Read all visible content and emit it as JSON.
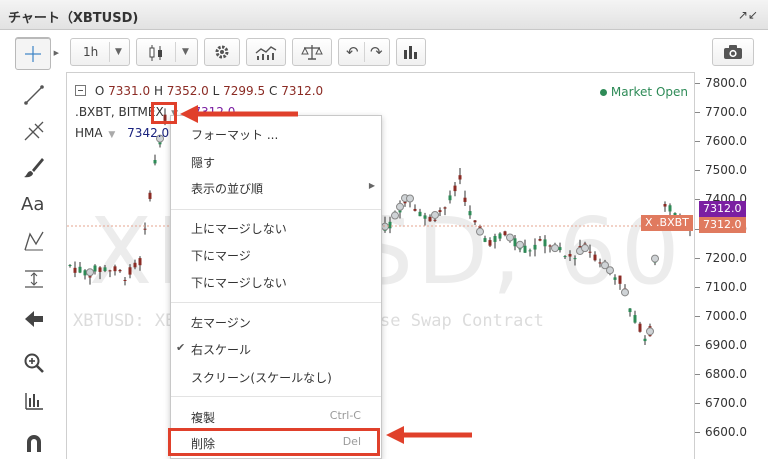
{
  "window": {
    "title": "チャート（XBTUSD)"
  },
  "toolbar": {
    "interval": "1h"
  },
  "chart": {
    "symbol_watermark": "XBTUSD, 60",
    "description_watermark": "XBTUSD: XBTUSD Perpetual Inverse Swap Contract",
    "ohlc": {
      "o_label": "O",
      "o": "7331.0",
      "h_label": "H",
      "h": "7352.0",
      "l_label": "L",
      "l": "7299.5",
      "c_label": "C",
      "c": "7312.0"
    },
    "market_status": "Market Open",
    "index_series": ".BXBT, BITMEX",
    "index_value": "7312.0",
    "indicator": "HMA",
    "indicator_value": "7342.090",
    "badges": [
      {
        "text": "7312.0",
        "color": "#7b1fa2"
      },
      {
        "text": "X .BXBT",
        "color": "#7b1fa2"
      },
      {
        "text": "7312.0",
        "color": "#e07a5f"
      }
    ]
  },
  "yaxis": {
    "ticks": [
      "7800.0",
      "7700.0",
      "7600.0",
      "7500.0",
      "7400.0",
      "7300.0",
      "7200.0",
      "7100.0",
      "7000.0",
      "6900.0",
      "6800.0",
      "6700.0",
      "6600.0"
    ]
  },
  "menu": {
    "items": [
      {
        "label": "フォーマット ..."
      },
      {
        "label": "隠す"
      },
      {
        "label": "表示の並び順"
      },
      {
        "label": "上にマージしない"
      },
      {
        "label": "下にマージ"
      },
      {
        "label": "下にマージしない"
      },
      {
        "label": "左マージン"
      },
      {
        "label": "右スケール"
      },
      {
        "label": "スクリーン(スケールなし)"
      },
      {
        "label": "複製",
        "shortcut": "Ctrl-C"
      },
      {
        "label": "削除",
        "shortcut": "Del"
      }
    ]
  },
  "colors": {
    "accent_red": "#e0402b",
    "candle_up": "#2e8b57",
    "candle_down": "#8b2b24",
    "index_purple": "#7b1fa2"
  }
}
